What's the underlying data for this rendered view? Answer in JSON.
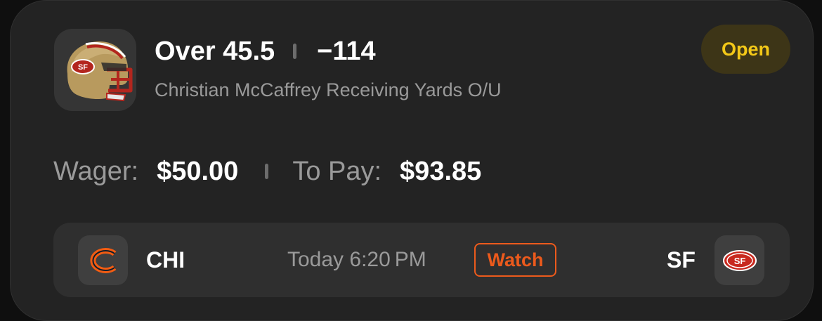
{
  "bet": {
    "selection": "Over 45.5",
    "odds": "−114",
    "market": "Christian McCaffrey Receiving Yards O/U",
    "status": "Open",
    "team_logo_icon": "49ers-helmet-icon"
  },
  "money": {
    "wager_label": "Wager:",
    "wager_value": "$50.00",
    "to_pay_label": "To Pay:",
    "to_pay_value": "$93.85"
  },
  "game": {
    "away_abbr": "CHI",
    "away_logo_icon": "bears-logo-icon",
    "time": "Today 6:20 PM",
    "watch_label": "Watch",
    "home_abbr": "SF",
    "home_logo_icon": "49ers-logo-icon"
  },
  "colors": {
    "card_bg": "#232323",
    "status_text": "#f3c818",
    "status_bg": "#3d3517",
    "watch_accent": "#ec5a1c",
    "muted_text": "#9a9a9a"
  }
}
